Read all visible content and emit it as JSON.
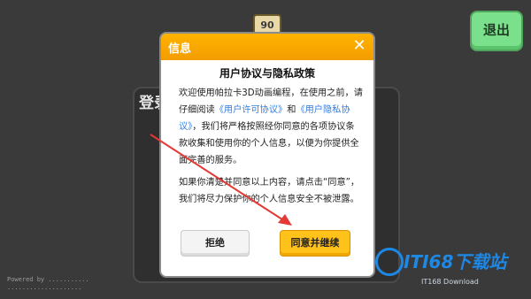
{
  "background": {
    "emblem_text": "90",
    "login_title": "登录",
    "footer_line1": "Powered by ...........",
    "footer_line2": "...................."
  },
  "exit_button": {
    "label": "退出"
  },
  "watermark": {
    "main": "ITI68下载站",
    "sub": "IT168 Download"
  },
  "dialog": {
    "title": "信息",
    "close_icon": "close-icon",
    "heading": "用户协议与隐私政策",
    "para1_part1": "欢迎使用帕拉卡3D动画编程，在使用之前，请仔细阅读",
    "link_user_license": "《用户许可协议》",
    "para1_and": "和",
    "link_privacy": "《用户隐私协议》",
    "para1_part2": "，我们将严格按照经你同意的各项协议条款收集和使用你的个人信息，以便为你提供全面完善的服务。",
    "para2": "如果你清楚并同意以上内容，请点击“同意”，我们将尽力保护你的个人信息安全不被泄露。",
    "reject_label": "拒绝",
    "agree_label": "同意并继续"
  },
  "colors": {
    "header": "#f5a300",
    "link": "#2f7ee6",
    "agree_button": "#ffc21a",
    "exit_button": "#7be08b",
    "arrow": "#e53935"
  }
}
